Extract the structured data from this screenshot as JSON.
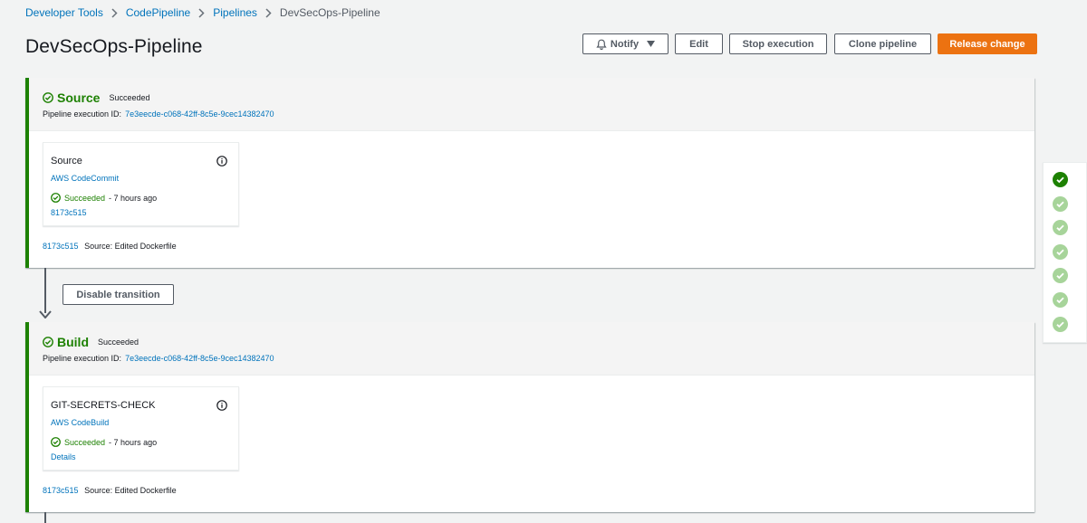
{
  "breadcrumb": {
    "items": [
      "Developer Tools",
      "CodePipeline",
      "Pipelines",
      "DevSecOps-Pipeline"
    ]
  },
  "page": {
    "title": "DevSecOps-Pipeline"
  },
  "actions": {
    "notify": "Notify",
    "edit": "Edit",
    "stop": "Stop execution",
    "clone": "Clone pipeline",
    "release": "Release change"
  },
  "colors": {
    "success": "#1d8102",
    "link": "#0073bb",
    "primary": "#ec7211",
    "background": "#f2f3f3"
  },
  "stages": [
    {
      "name": "Source",
      "status": "Succeeded",
      "exec_label": "Pipeline execution ID:",
      "exec_id": "7e3eecde-c068-42ff-8c5e-9cec14382470",
      "action": {
        "name": "Source",
        "provider": "AWS CodeCommit",
        "status": "Succeeded",
        "time": "- 7 hours ago",
        "link": "8173c515"
      },
      "footer": {
        "commit": "8173c515",
        "message": "Source: Edited Dockerfile"
      }
    },
    {
      "name": "Build",
      "status": "Succeeded",
      "exec_label": "Pipeline execution ID:",
      "exec_id": "7e3eecde-c068-42ff-8c5e-9cec14382470",
      "action": {
        "name": "GIT-SECRETS-CHECK",
        "provider": "AWS CodeBuild",
        "status": "Succeeded",
        "time": "- 7 hours ago",
        "link": "Details"
      },
      "footer": {
        "commit": "8173c515",
        "message": "Source: Edited Dockerfile"
      }
    }
  ],
  "transition": {
    "label": "Disable transition"
  },
  "mini_nav": {
    "count": 7,
    "active_index": 0,
    "icon": "check-circle-icon"
  }
}
